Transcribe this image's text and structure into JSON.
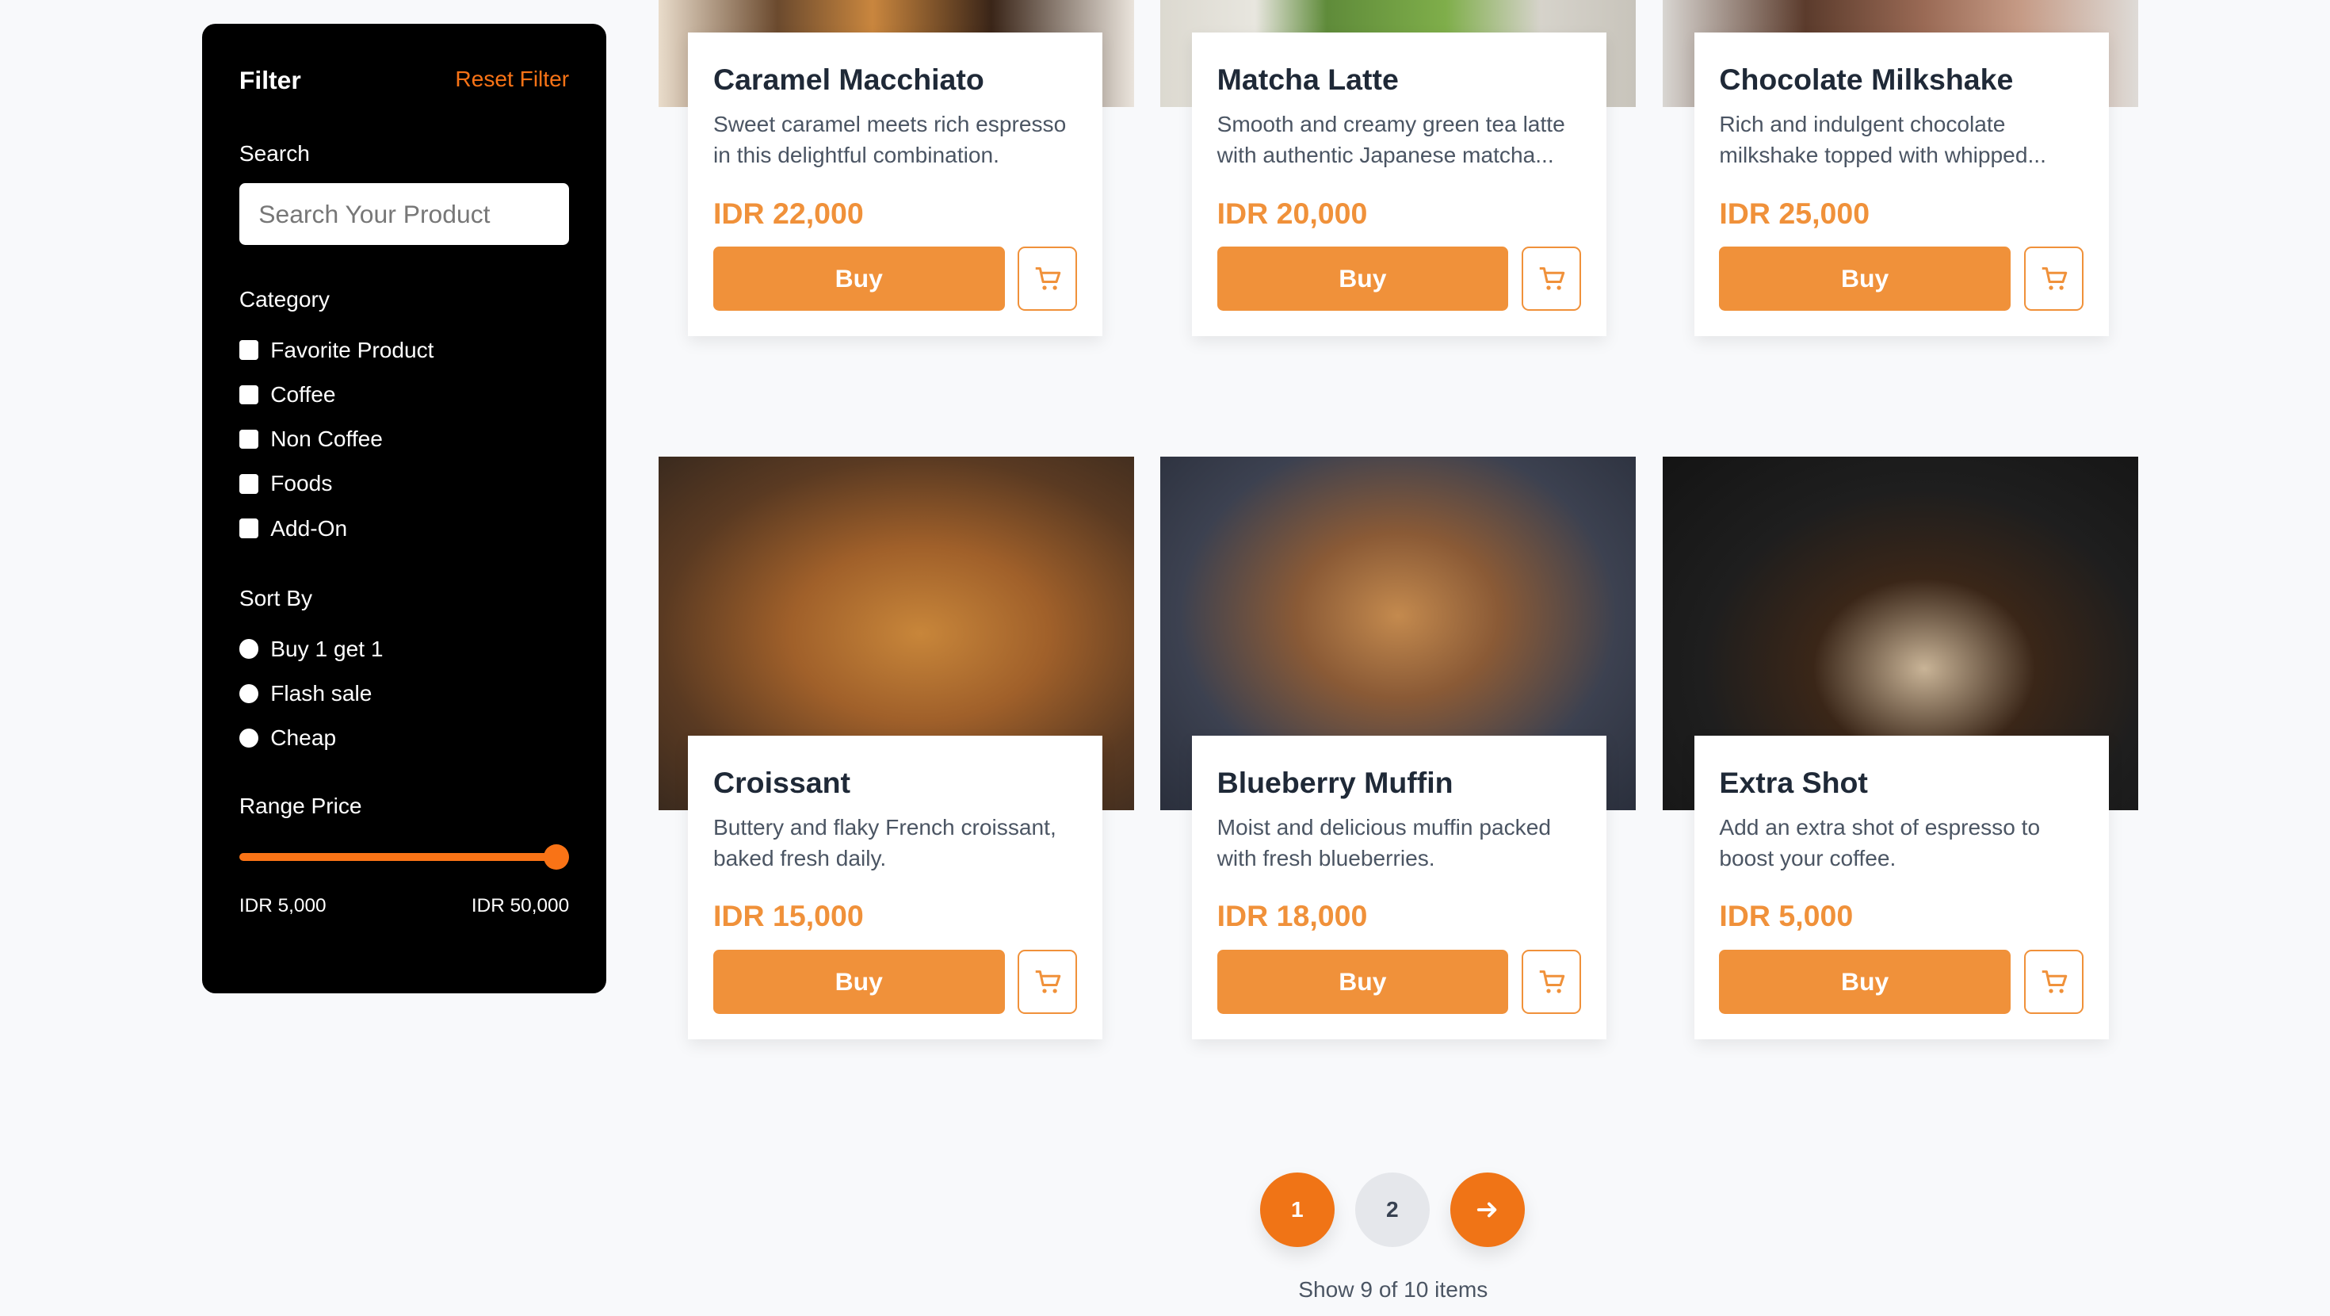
{
  "sidebar": {
    "title": "Filter",
    "reset_label": "Reset Filter",
    "search_label": "Search",
    "search_placeholder": "Search Your Product",
    "search_value": "",
    "category_label": "Category",
    "categories": [
      {
        "label": "Favorite Product",
        "checked": false
      },
      {
        "label": "Coffee",
        "checked": false
      },
      {
        "label": "Non Coffee",
        "checked": false
      },
      {
        "label": "Foods",
        "checked": false
      },
      {
        "label": "Add-On",
        "checked": false
      }
    ],
    "sort_label": "Sort By",
    "sort_options": [
      {
        "label": "Buy 1 get 1",
        "selected": false
      },
      {
        "label": "Flash sale",
        "selected": false
      },
      {
        "label": "Cheap",
        "selected": false
      }
    ],
    "range_label": "Range Price",
    "range_min": "IDR 5,000",
    "range_max": "IDR 50,000",
    "range_value_percent": 100
  },
  "products": [
    {
      "name": "Caramel Macchiato",
      "description": "Sweet caramel meets rich espresso in this delightful combination.",
      "price": "IDR 22,000",
      "buy_label": "Buy",
      "image": "caramel-macchiato-photo"
    },
    {
      "name": "Matcha Latte",
      "description": "Smooth and creamy green tea latte with authentic Japanese matcha...",
      "price": "IDR 20,000",
      "buy_label": "Buy",
      "image": "matcha-latte-photo"
    },
    {
      "name": "Chocolate Milkshake",
      "description": "Rich and indulgent chocolate milkshake topped with whipped...",
      "price": "IDR 25,000",
      "buy_label": "Buy",
      "image": "chocolate-milkshake-photo"
    },
    {
      "name": "Croissant",
      "description": "Buttery and flaky French croissant, baked fresh daily.",
      "price": "IDR 15,000",
      "buy_label": "Buy",
      "image": "croissant-photo"
    },
    {
      "name": "Blueberry Muffin",
      "description": "Moist and delicious muffin packed with fresh blueberries.",
      "price": "IDR 18,000",
      "buy_label": "Buy",
      "image": "blueberry-muffin-photo"
    },
    {
      "name": "Extra Shot",
      "description": "Add an extra shot of espresso to boost your coffee.",
      "price": "IDR 5,000",
      "buy_label": "Buy",
      "image": "extra-shot-photo"
    }
  ],
  "pagination": {
    "pages": [
      "1",
      "2"
    ],
    "current": "1",
    "next_icon": "arrow-right-icon",
    "info": "Show 9 of 10 items"
  },
  "colors": {
    "accent": "#f97316",
    "button": "#f0913a",
    "background": "#f8f9fb",
    "sidebar": "#000000"
  }
}
